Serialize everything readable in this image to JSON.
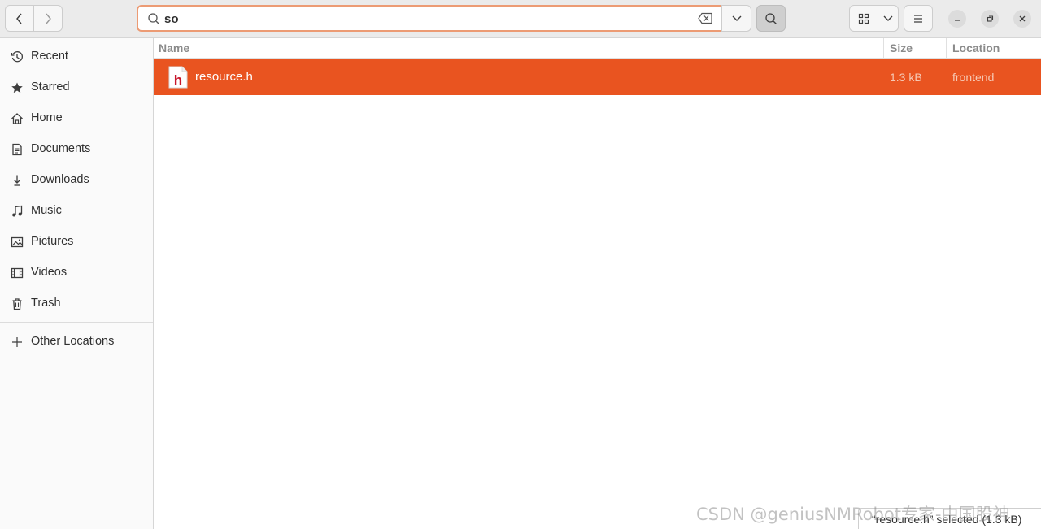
{
  "search": {
    "value": "so",
    "placeholder": ""
  },
  "sidebar": {
    "items": [
      {
        "label": "Recent",
        "icon": "clock-icon"
      },
      {
        "label": "Starred",
        "icon": "star-icon"
      },
      {
        "label": "Home",
        "icon": "home-icon"
      },
      {
        "label": "Documents",
        "icon": "document-icon"
      },
      {
        "label": "Downloads",
        "icon": "download-icon"
      },
      {
        "label": "Music",
        "icon": "music-icon"
      },
      {
        "label": "Pictures",
        "icon": "picture-icon"
      },
      {
        "label": "Videos",
        "icon": "video-icon"
      },
      {
        "label": "Trash",
        "icon": "trash-icon"
      }
    ],
    "other": {
      "label": "Other Locations",
      "icon": "plus-icon"
    }
  },
  "list": {
    "columns": {
      "name": "Name",
      "size": "Size",
      "location": "Location"
    },
    "rows": [
      {
        "name": "resource.h",
        "size": "1.3 kB",
        "location": "frontend",
        "icon": "h",
        "selected": true
      }
    ]
  },
  "status": {
    "text": "“resource.h” selected  (1.3 kB)"
  },
  "watermark": {
    "text": "CSDN @geniusNMRobot专家-中国股神"
  },
  "colors": {
    "accent": "#e95420",
    "search_border": "#ec9b74",
    "file_icon_letter": "#c7162b"
  }
}
